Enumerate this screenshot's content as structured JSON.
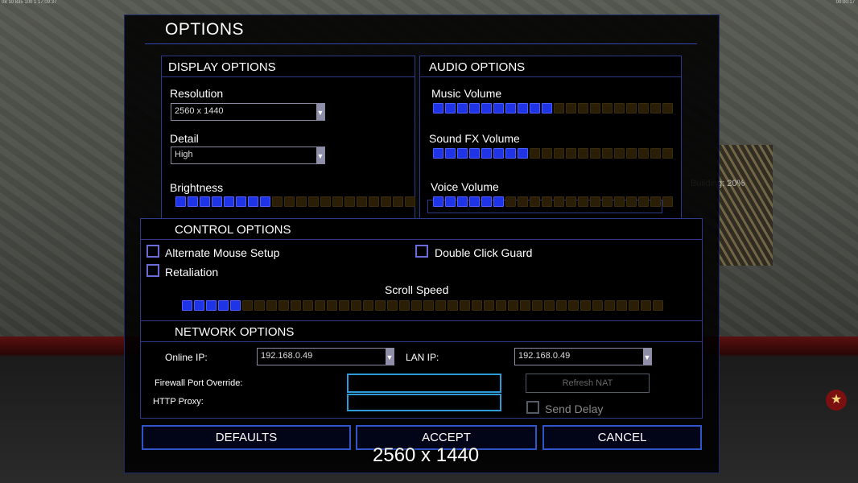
{
  "hud": {
    "top_left": "08 10 835 100 1 17:09:37",
    "top_right": "00:00:17",
    "building_label": "Building: 20%"
  },
  "dialog": {
    "title": "OPTIONS",
    "display": {
      "header": "DISPLAY OPTIONS",
      "resolution_label": "Resolution",
      "resolution_value": "2560 x 1440",
      "detail_label": "Detail",
      "detail_value": "High",
      "brightness_label": "Brightness",
      "brightness_level": 8,
      "brightness_total": 20
    },
    "audio": {
      "header": "AUDIO OPTIONS",
      "music_label": "Music Volume",
      "music_level": 10,
      "music_total": 20,
      "sfx_label": "Sound FX Volume",
      "sfx_level": 8,
      "sfx_total": 20,
      "voice_label": "Voice Volume",
      "voice_level": 6,
      "voice_total": 20
    },
    "control": {
      "header": "CONTROL OPTIONS",
      "alt_mouse_label": "Alternate Mouse Setup",
      "alt_mouse_checked": false,
      "retaliation_label": "Retaliation",
      "retaliation_checked": false,
      "double_click_label": "Double Click Guard",
      "double_click_checked": false,
      "scroll_label": "Scroll Speed",
      "scroll_level": 5,
      "scroll_total": 40
    },
    "network": {
      "header": "NETWORK OPTIONS",
      "online_ip_label": "Online IP:",
      "online_ip_value": "192.168.0.49",
      "lan_ip_label": "LAN IP:",
      "lan_ip_value": "192.168.0.49",
      "firewall_label": "Firewall Port Override:",
      "firewall_value": "",
      "http_proxy_label": "HTTP Proxy:",
      "http_proxy_value": "",
      "refresh_nat_label": "Refresh NAT",
      "send_delay_label": "Send Delay",
      "send_delay_checked": false
    },
    "buttons": {
      "defaults": "DEFAULTS",
      "accept": "ACCEPT",
      "cancel": "CANCEL"
    },
    "overlay_text": "2560 x 1440"
  },
  "colors": {
    "slider_on": "#1f34e6",
    "slider_off": "#2a1f06",
    "frame": "#2d3a8a",
    "field_border": "#2e9ad8"
  }
}
